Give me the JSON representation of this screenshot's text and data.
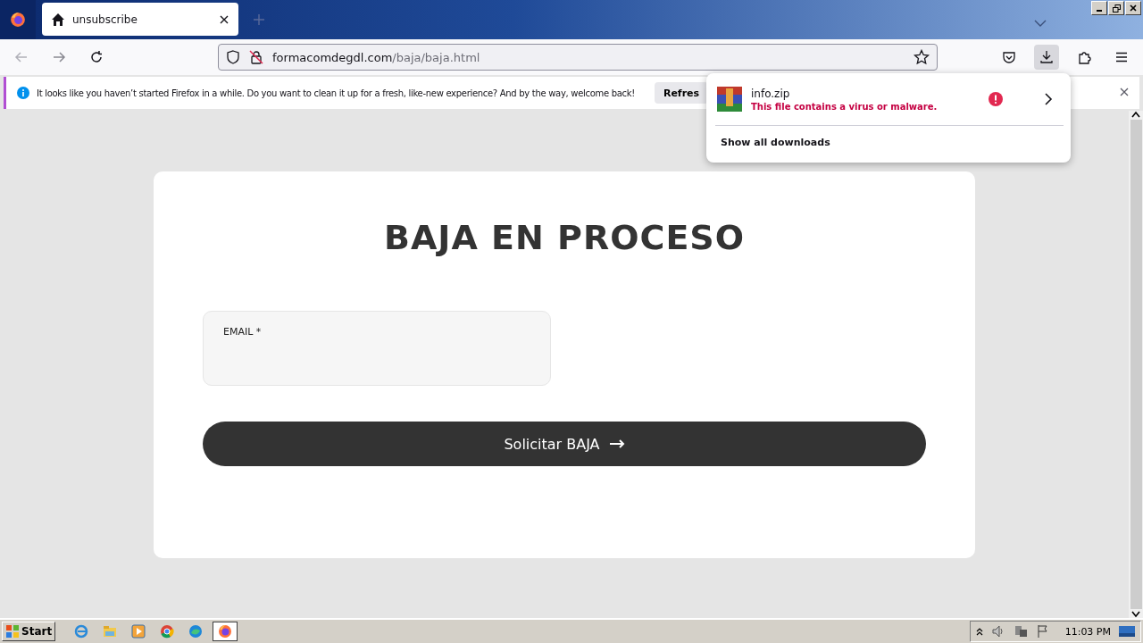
{
  "tabs": [
    {
      "title": "unsubscribe",
      "selected": true
    }
  ],
  "address_bar": {
    "domain": "formacomdegdl.com",
    "path": "/baja/baja.html"
  },
  "notification": {
    "message": "It looks like you haven’t started Firefox in a while. Do you want to clean it up for a fresh, like-new experience? And by the way, welcome back!",
    "button": "Refres"
  },
  "downloads_panel": {
    "items": [
      {
        "name": "info.zip",
        "status": "This file contains a virus or malware."
      }
    ],
    "footer": "Show all downloads"
  },
  "page": {
    "heading": "BAJA EN PROCESO",
    "fields": [
      {
        "label": "EMAIL *"
      }
    ],
    "submit": "Solicitar BAJA"
  },
  "taskbar": {
    "start": "Start",
    "apps": [
      {
        "kind": "ie",
        "selected": false
      },
      {
        "kind": "explorer",
        "selected": false
      },
      {
        "kind": "media",
        "selected": false
      },
      {
        "kind": "chrome",
        "selected": false
      },
      {
        "kind": "edge",
        "selected": false
      },
      {
        "kind": "firefox",
        "selected": true
      }
    ],
    "clock": "11:03 PM"
  }
}
